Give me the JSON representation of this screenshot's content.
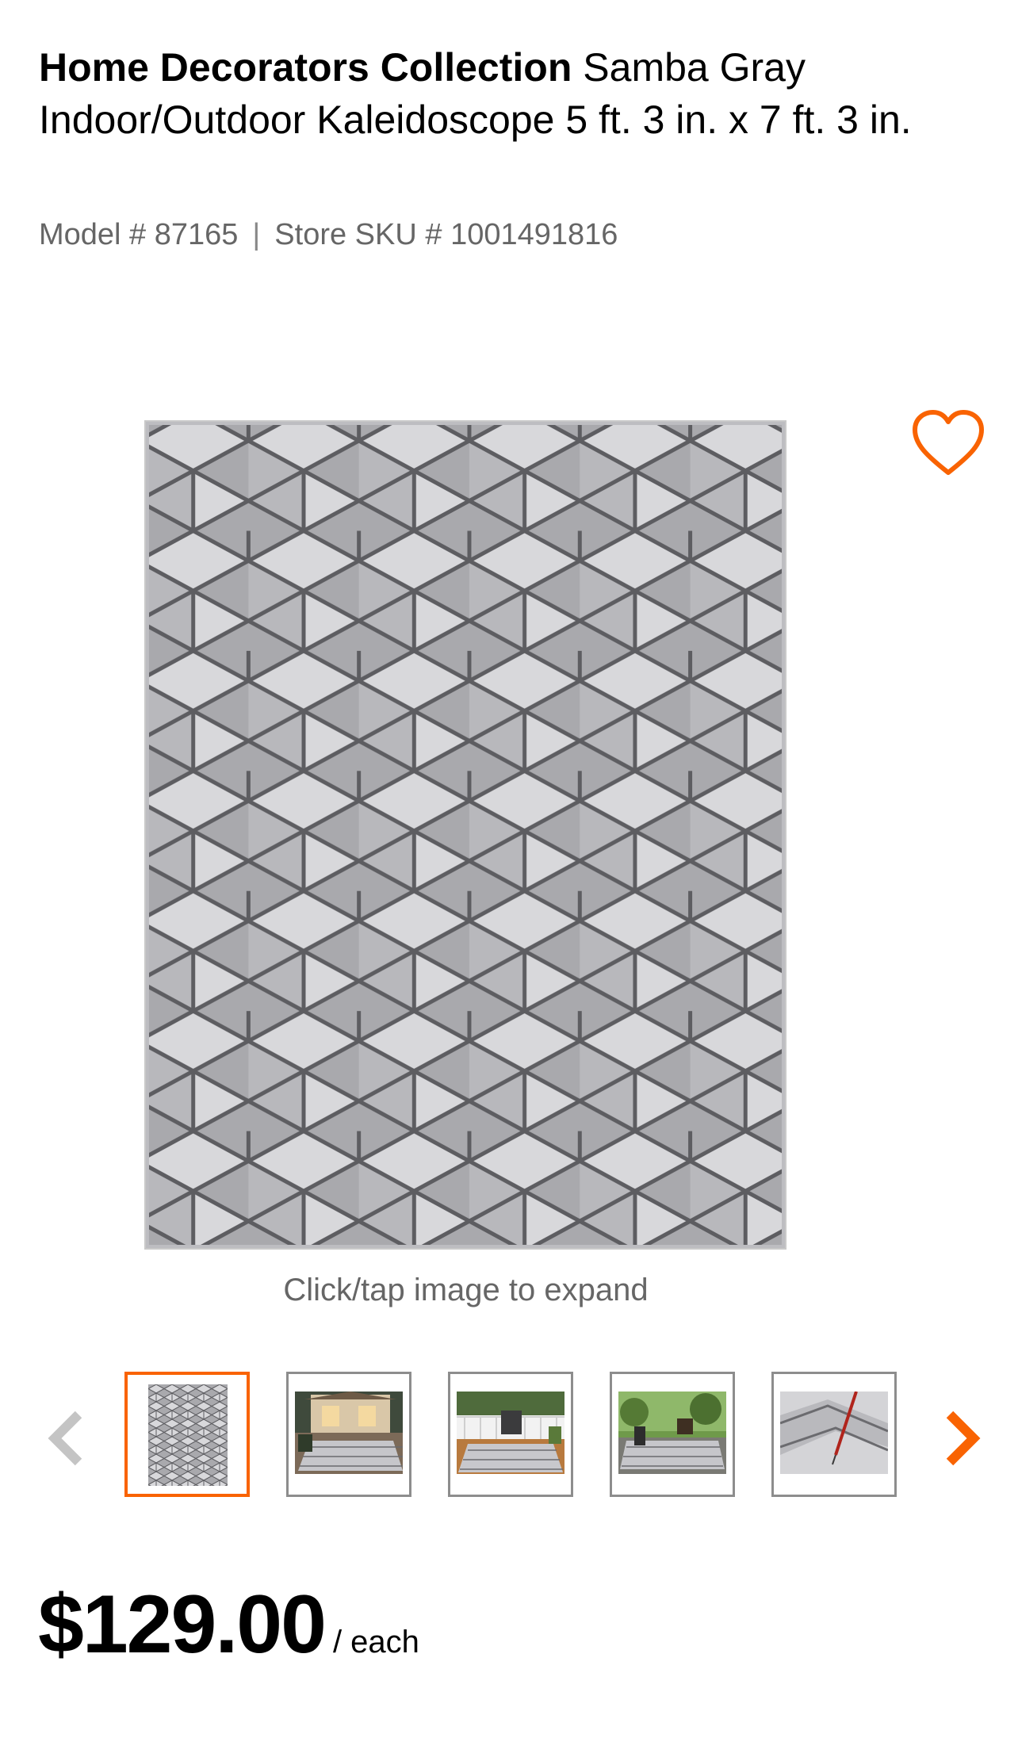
{
  "product": {
    "brand": "Home Decorators Collection",
    "name": "Samba Gray Indoor/Outdoor Kaleidoscope 5 ft. 3 in. x 7 ft. 3 in.",
    "model_label": "Model # 87165",
    "separator": "|",
    "sku_label": "Store SKU # 1001491816"
  },
  "gallery": {
    "expand_hint": "Click/tap image to expand",
    "favorite_icon": "heart-outline-icon",
    "prev_icon": "chevron-left-icon",
    "next_icon": "chevron-right-icon",
    "thumbnails": [
      {
        "name": "thumb-rug-flat",
        "active": true
      },
      {
        "name": "thumb-rug-patio-house",
        "active": false
      },
      {
        "name": "thumb-rug-deck-grill",
        "active": false
      },
      {
        "name": "thumb-rug-garden",
        "active": false
      },
      {
        "name": "thumb-rug-closeup",
        "active": false
      }
    ]
  },
  "pricing": {
    "amount": "$129.00",
    "unit": "/ each"
  },
  "colors": {
    "accent": "#f96302",
    "text_primary": "#000000",
    "text_secondary": "#666666",
    "rug_base": "#a7a7ab",
    "rug_light": "#d9d9dc",
    "rug_line": "#5e5e62"
  }
}
